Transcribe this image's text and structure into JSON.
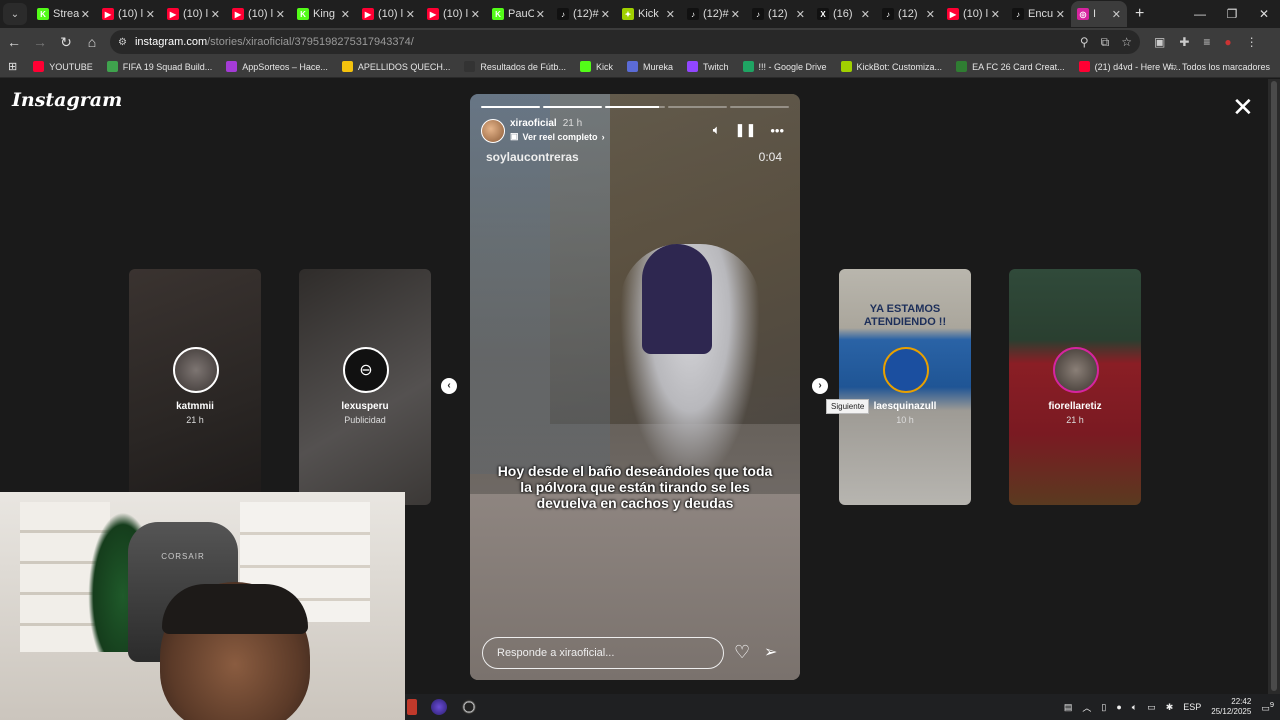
{
  "browser": {
    "tabs": [
      {
        "title": "Strea",
        "color": "#53fc18",
        "glyph": "K"
      },
      {
        "title": "(10) l",
        "color": "#ff0033",
        "glyph": "▶"
      },
      {
        "title": "(10) l",
        "color": "#ff0033",
        "glyph": "▶"
      },
      {
        "title": "(10) l",
        "color": "#ff0033",
        "glyph": "▶"
      },
      {
        "title": "King",
        "color": "#53fc18",
        "glyph": "K"
      },
      {
        "title": "(10) l",
        "color": "#ff0033",
        "glyph": "▶"
      },
      {
        "title": "(10) l",
        "color": "#ff0033",
        "glyph": "▶"
      },
      {
        "title": "PauC",
        "color": "#53fc18",
        "glyph": "K"
      },
      {
        "title": "(12)#",
        "color": "#111111",
        "glyph": "♪"
      },
      {
        "title": "Kick",
        "color": "#a0d000",
        "glyph": "✦"
      },
      {
        "title": "(12)#",
        "color": "#111111",
        "glyph": "♪"
      },
      {
        "title": "(12)",
        "color": "#111111",
        "glyph": "♪"
      },
      {
        "title": "(16)",
        "color": "#111111",
        "glyph": "X"
      },
      {
        "title": "(12)",
        "color": "#111111",
        "glyph": "♪"
      },
      {
        "title": "(10) l",
        "color": "#ff0033",
        "glyph": "▶"
      },
      {
        "title": "Encu",
        "color": "#111111",
        "glyph": "♪"
      },
      {
        "title": "I",
        "color": "#d6249f",
        "glyph": "◎",
        "active": true
      }
    ],
    "url_host": "instagram.com",
    "url_path": "/stories/xiraoficial/3795198275317943374/",
    "bookmarks": [
      {
        "label": "YOUTUBE",
        "color": "#ff0033"
      },
      {
        "label": "FIFA 19 Squad Build...",
        "color": "#3fa34d"
      },
      {
        "label": "AppSorteos – Hace...",
        "color": "#a43bd6"
      },
      {
        "label": "APELLIDOS QUECH...",
        "color": "#f4c20d"
      },
      {
        "label": "Resultados de Fútb...",
        "color": "#333333"
      },
      {
        "label": "Kick",
        "color": "#53fc18"
      },
      {
        "label": "Mureka",
        "color": "#5b6bd6"
      },
      {
        "label": "Twitch",
        "color": "#9146ff"
      },
      {
        "label": "!!! - Google Drive",
        "color": "#1fa463"
      },
      {
        "label": "KickBot: Customiza...",
        "color": "#a0d000"
      },
      {
        "label": "EA FC 26 Card Creat...",
        "color": "#2f7d32"
      },
      {
        "label": "(21) d4vd - Here Wi...",
        "color": "#ff0033"
      }
    ],
    "all_bookmarks": "Todos los marcadores"
  },
  "instagram": {
    "logo": "Instagram",
    "side_stories": [
      {
        "username": "katmmii",
        "sub": "21 h"
      },
      {
        "username": "lexusperu",
        "sub": "Publicidad"
      },
      {
        "username": "laesquinazull",
        "sub": "10 h",
        "banner": "YA ESTAMOS ATENDIENDO !!"
      },
      {
        "username": "fiorellaretiz",
        "sub": "21 h"
      }
    ],
    "tooltip": "Siguiente",
    "main_story": {
      "username": "xiraoficial",
      "time": "21 h",
      "reel_link": "Ver reel completo",
      "audio_user": "soylaucontreras",
      "duration": "0:04",
      "progress": [
        1,
        1,
        0.9,
        0,
        0
      ],
      "caption": "Hoy desde el baño deseándoles que toda la pólvora que están tirando se les devuelva en cachos y deudas",
      "reply_placeholder": "Responde a xiraoficial..."
    }
  },
  "taskbar": {
    "lang": "ESP",
    "time": "22:42",
    "date": "25/12/2025",
    "notifications": "9"
  }
}
